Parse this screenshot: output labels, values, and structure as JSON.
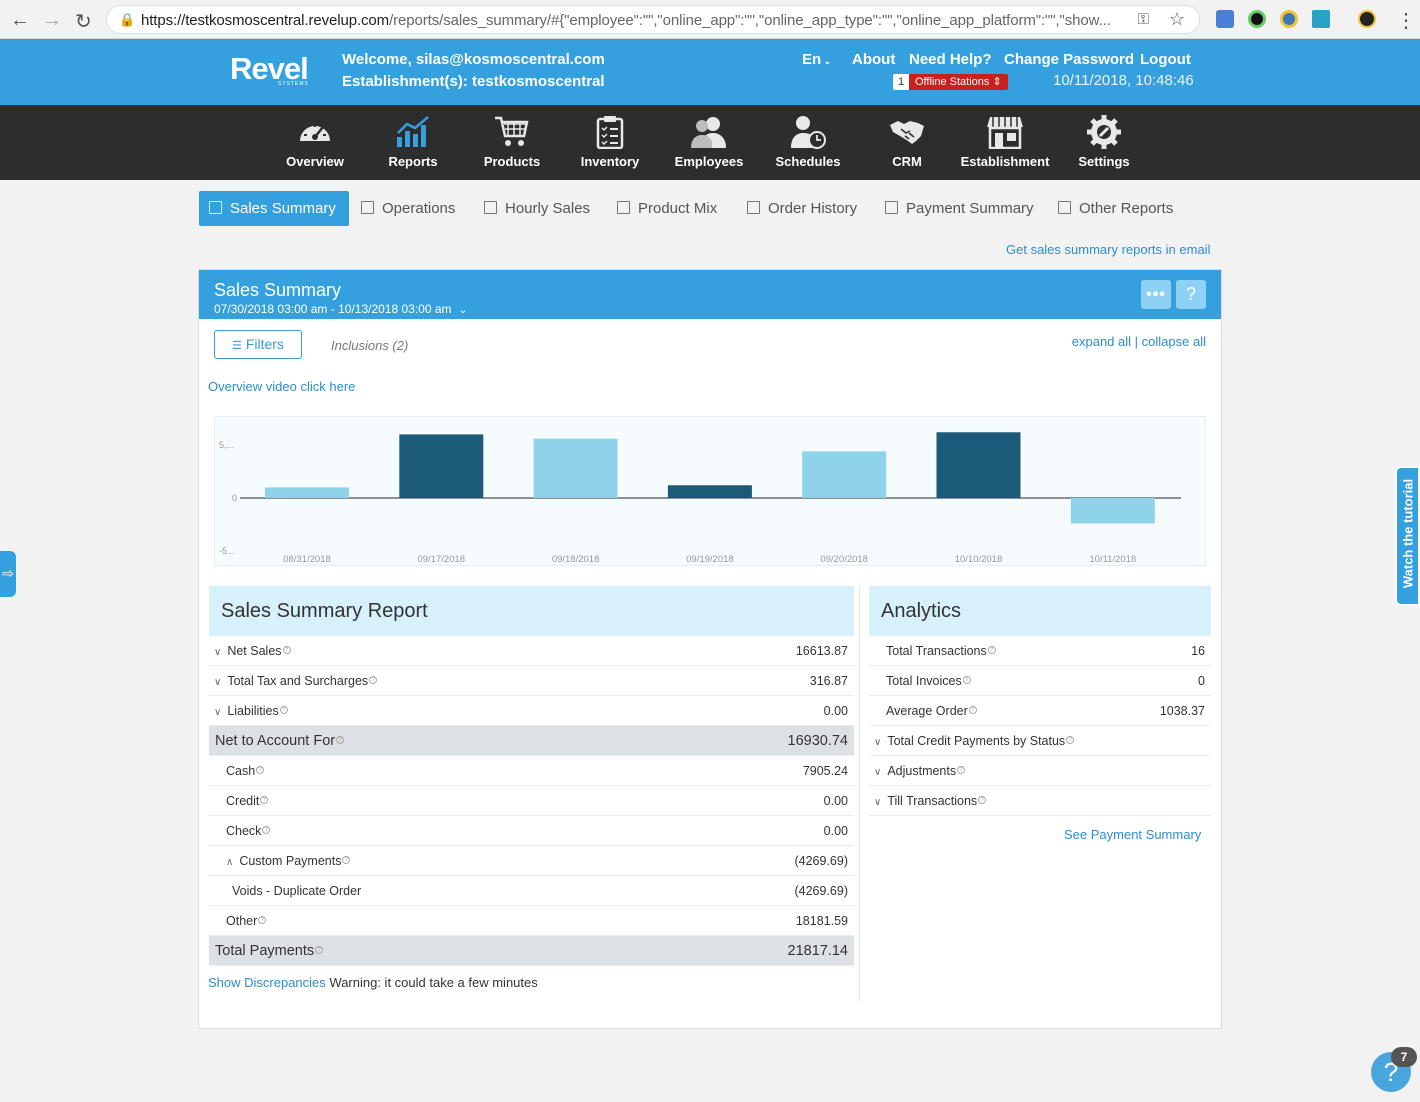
{
  "browser": {
    "url_host": "https://testkosmoscentral.revelup.com",
    "url_path": "/reports/sales_summary/#{\"employee\":\"\",\"online_app\":\"\",\"online_app_type\":\"\",\"online_app_platform\":\"\",\"show..."
  },
  "header": {
    "logo": "Revel",
    "logo_sub": "SYSTEMS",
    "welcome": "Welcome, silas@kosmoscentral.com",
    "establishment": "Establishment(s): testkosmoscentral",
    "lang": "En",
    "about": "About",
    "help": "Need Help?",
    "change_password": "Change Password",
    "logout": "Logout",
    "offline_count": "1",
    "offline_label": "Offline Stations",
    "datetime": "10/11/2018, 10:48:46"
  },
  "nav": [
    {
      "label": "Overview",
      "icon": "speedometer-icon"
    },
    {
      "label": "Reports",
      "icon": "chart-icon"
    },
    {
      "label": "Products",
      "icon": "cart-icon"
    },
    {
      "label": "Inventory",
      "icon": "clipboard-icon"
    },
    {
      "label": "Employees",
      "icon": "people-icon"
    },
    {
      "label": "Schedules",
      "icon": "person-clock-icon"
    },
    {
      "label": "CRM",
      "icon": "handshake-icon"
    },
    {
      "label": "Establishment",
      "icon": "store-icon"
    },
    {
      "label": "Settings",
      "icon": "gear-icon"
    }
  ],
  "subtabs": [
    "Sales Summary",
    "Operations",
    "Hourly Sales",
    "Product Mix",
    "Order History",
    "Payment Summary",
    "Other Reports"
  ],
  "email_link": "Get sales summary reports in email",
  "panel": {
    "title": "Sales Summary",
    "daterange": "07/30/2018 03:00 am - 10/13/2018 03:00 am",
    "filters": "Filters",
    "inclusions": "Inclusions (2)",
    "expand_all": "expand all",
    "separator": "|",
    "collapse_all": "collapse all",
    "video_link": "Overview video click here"
  },
  "chart_data": {
    "type": "bar",
    "categories": [
      "08/31/2018",
      "09/17/2018",
      "09/18/2018",
      "09/19/2018",
      "09/20/2018",
      "10/10/2018",
      "10/11/2018"
    ],
    "values": [
      1000,
      6000,
      5600,
      1200,
      4400,
      6200,
      -2400
    ],
    "colors": [
      "#8ed3ea",
      "#1b5a78",
      "#8ed3ea",
      "#1b5a78",
      "#8ed3ea",
      "#1b5a78",
      "#8ed3ea"
    ],
    "ytick_labels": [
      "5,...",
      "0",
      "-5..."
    ],
    "ytick_values": [
      5000,
      0,
      -5000
    ],
    "ylim": [
      -5000,
      5000
    ],
    "grid": false
  },
  "sales_report": {
    "title": "Sales Summary Report",
    "rows": [
      {
        "label": "Net Sales",
        "value": "16613.87"
      },
      {
        "label": "Total Tax and Surcharges",
        "value": "316.87"
      },
      {
        "label": "Liabilities",
        "value": "0.00"
      },
      {
        "label": "Net to Account For",
        "value": "16930.74"
      },
      {
        "label": "Cash",
        "value": "7905.24"
      },
      {
        "label": "Credit",
        "value": "0.00"
      },
      {
        "label": "Check",
        "value": "0.00"
      },
      {
        "label": "Custom Payments",
        "value": "(4269.69)"
      },
      {
        "label": "Voids - Duplicate Order",
        "value": "(4269.69)"
      },
      {
        "label": "Other",
        "value": "18181.59"
      },
      {
        "label": "Total Payments",
        "value": "21817.14"
      }
    ],
    "show_disc": "Show Discrepancies",
    "warning": "Warning: it could take a few minutes"
  },
  "analytics": {
    "title": "Analytics",
    "rows": [
      {
        "label": "Total Transactions",
        "value": "16"
      },
      {
        "label": "Total Invoices",
        "value": "0"
      },
      {
        "label": "Average Order",
        "value": "1038.37"
      },
      {
        "label": "Total Credit Payments by Status",
        "value": ""
      },
      {
        "label": "Adjustments",
        "value": ""
      },
      {
        "label": "Till Transactions",
        "value": ""
      }
    ],
    "see_payment": "See Payment Summary"
  },
  "tutorial": "Watch the tutorial",
  "help_badge": "7",
  "colors": {
    "brand_blue": "#35a0de",
    "dark_nav": "#2d2d2d",
    "bar_light": "#8ed3ea",
    "bar_dark": "#1b5a78",
    "section_head": "#d6f1fb"
  }
}
